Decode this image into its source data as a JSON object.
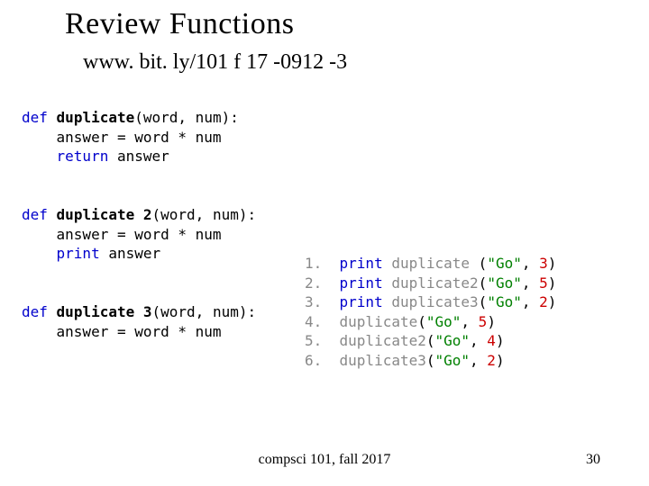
{
  "title": "Review Functions",
  "subtitle": "www. bit. ly/101 f 17 -0912 -3",
  "footer_center": "compsci 101, fall 2017",
  "slide_number": "30",
  "code": {
    "kw_def": "def",
    "kw_return": "return",
    "kw_print": "print",
    "fn1": "duplicate",
    "fn2": "duplicate 2",
    "fn3": "duplicate 3",
    "sig": "(word, num):",
    "sig3": "(word, num):",
    "line_assign": "    answer = word * num",
    "line_return": " answer",
    "line_print": " answer"
  },
  "calls": {
    "n1": "1.  ",
    "n2": "2.  ",
    "n3": "3.  ",
    "n4": "4.  ",
    "n5": "5.  ",
    "n6": "6.  ",
    "print": "print",
    "c_dup": " duplicate ",
    "c_dup2": " duplicate2",
    "c_dup3": " duplicate3",
    "c_dup_plain": "duplicate",
    "c_dup2_plain": "duplicate2",
    "c_dup3_plain": "duplicate3",
    "go": "\"Go\"",
    "lp": "(",
    "rp": ")",
    "comma": ", ",
    "v3": "3",
    "v5": "5",
    "v2": "2",
    "v4": "4"
  }
}
